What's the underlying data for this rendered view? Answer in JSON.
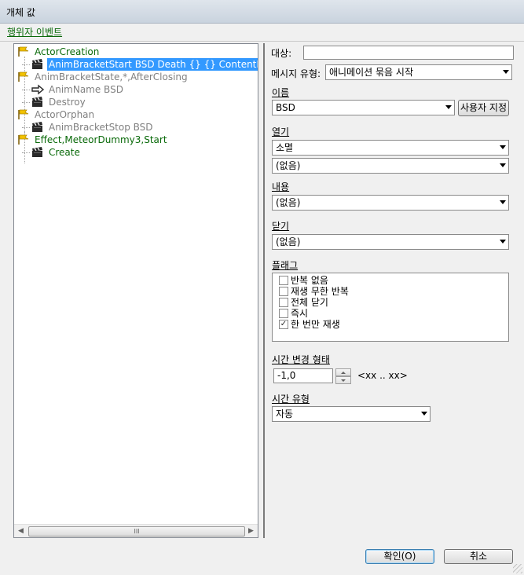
{
  "window": {
    "title": "개체 값"
  },
  "header": {
    "link": "행위자 이벤트"
  },
  "tree": {
    "nodes": [
      {
        "label": "ActorCreation",
        "icon": "flag-icon",
        "state": "normal"
      },
      {
        "label": "AnimBracketStart BSD Death {} {} ContentPlay",
        "icon": "clapperboard-icon",
        "state": "selected"
      },
      {
        "label": "AnimBracketState,*,AfterClosing",
        "icon": "flag-icon",
        "state": "disabled"
      },
      {
        "label": "AnimName BSD",
        "icon": "arrow-right-icon",
        "state": "disabled"
      },
      {
        "label": "Destroy",
        "icon": "clapperboard-icon",
        "state": "disabled"
      },
      {
        "label": "ActorOrphan",
        "icon": "flag-icon",
        "state": "disabled"
      },
      {
        "label": "AnimBracketStop BSD",
        "icon": "clapperboard-icon",
        "state": "disabled"
      },
      {
        "label": "Effect,MeteorDummy3,Start",
        "icon": "flag-icon",
        "state": "normal"
      },
      {
        "label": "Create",
        "icon": "clapperboard-icon",
        "state": "normal"
      }
    ],
    "scroll_thumb_glyph": "III"
  },
  "form": {
    "target_label": "대상:",
    "target_value": "",
    "message_type_label": "메시지 유형:",
    "message_type_value": "애니메이션 묶음 시작",
    "name_label": "이름",
    "name_value": "BSD",
    "custom_button": "사용자 지정",
    "open_label": "열기",
    "open_value_1": "소멸",
    "open_value_2": "(없음)",
    "content_label": "내용",
    "content_value": "(없음)",
    "close_label": "닫기",
    "close_value": "(없음)",
    "flags_label": "플래그",
    "flags": [
      {
        "label": "반복 없음",
        "checked": false
      },
      {
        "label": "재생 무한 반복",
        "checked": false
      },
      {
        "label": "전체 닫기",
        "checked": false
      },
      {
        "label": "즉시",
        "checked": false
      },
      {
        "label": "한 번만 재생",
        "checked": true
      }
    ],
    "time_scale_label": "시간 변경 형태",
    "time_scale_value": "-1,0",
    "time_scale_hint": "<xx .. xx>",
    "time_type_label": "시간 유형",
    "time_type_value": "자동"
  },
  "buttons": {
    "ok": "확인(O)",
    "cancel": "취소"
  }
}
